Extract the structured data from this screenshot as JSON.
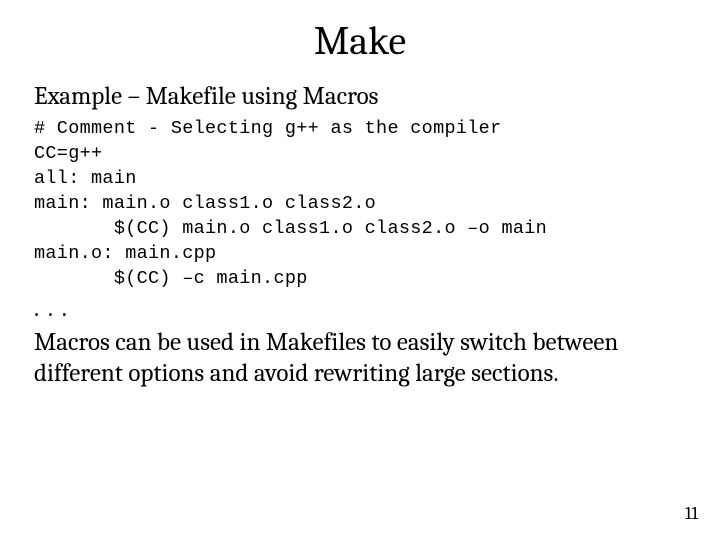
{
  "title": "Make",
  "subtitle": "Example – Makefile using Macros",
  "code": "# Comment - Selecting g++ as the compiler\nCC=g++\nall: main\nmain: main.o class1.o class2.o\n       $(CC) main.o class1.o class2.o –o main\nmain.o: main.cpp\n       $(CC) –c main.cpp",
  "ellipsis": ". . .",
  "body": "Macros can be used in Makefiles to easily switch between different options and avoid rewriting large sections.",
  "page_number": "11"
}
